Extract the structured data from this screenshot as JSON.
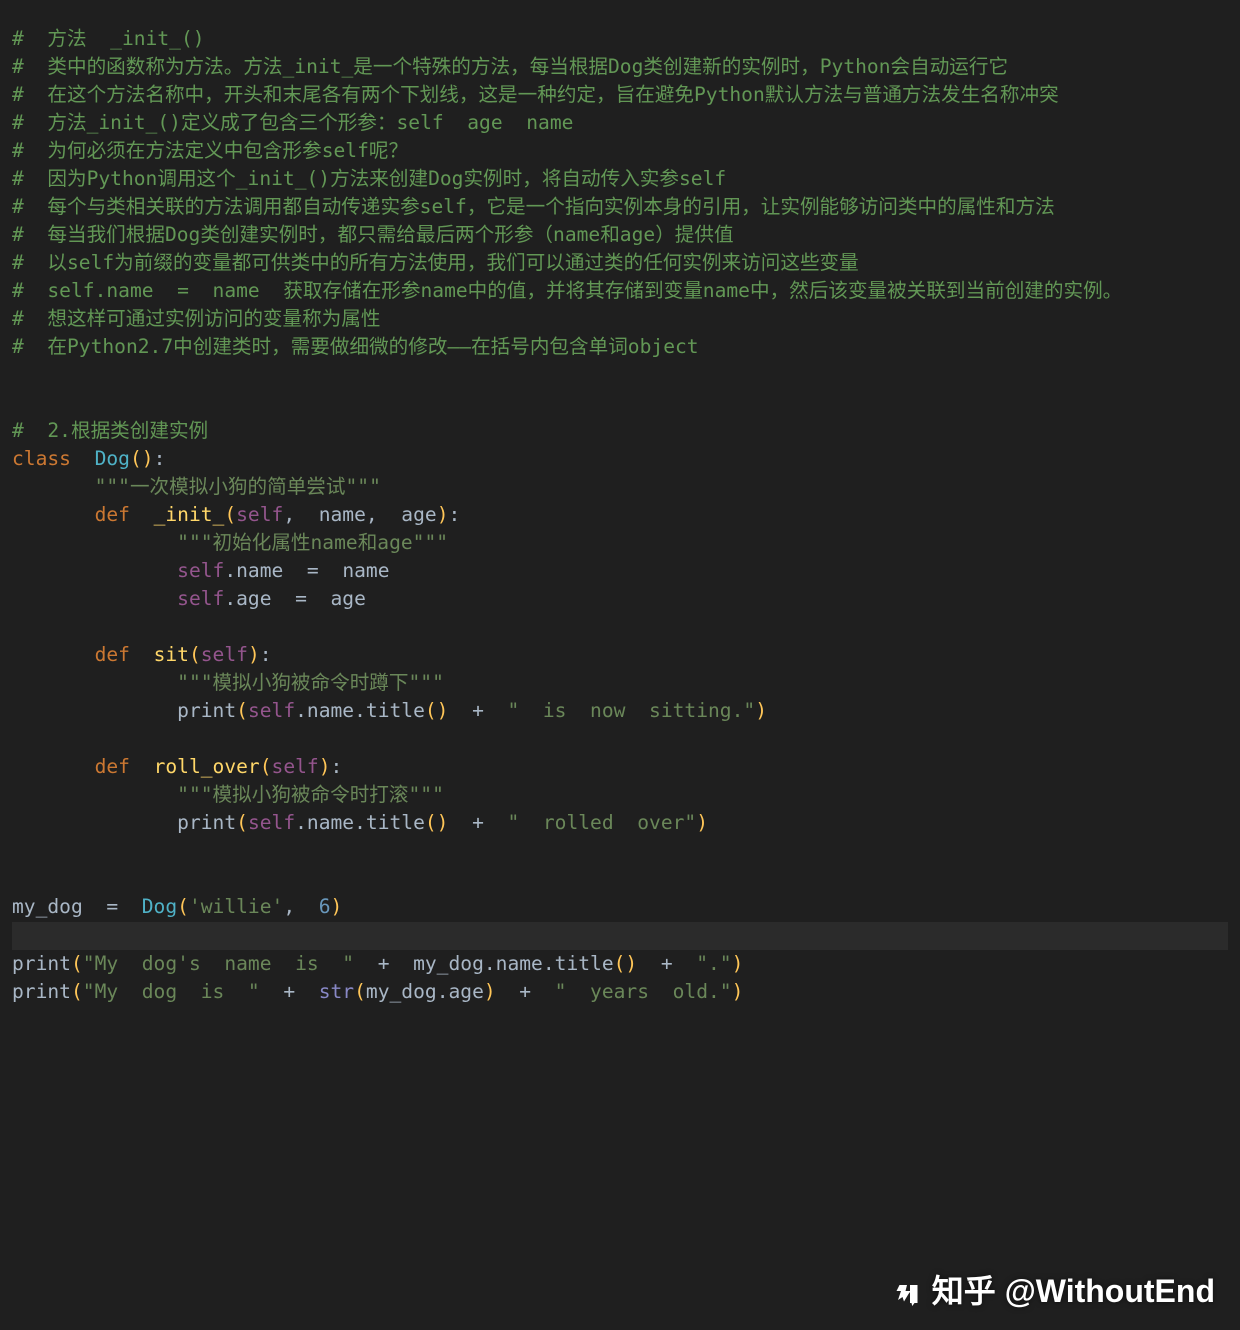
{
  "comments": {
    "c1": "#  方法  _init_()",
    "c2": "#  类中的函数称为方法。方法_init_是一个特殊的方法，每当根据Dog类创建新的实例时，Python会自动运行它",
    "c3": "#  在这个方法名称中，开头和末尾各有两个下划线，这是一种约定，旨在避免Python默认方法与普通方法发生名称冲突",
    "c4": "#  方法_init_()定义成了包含三个形参：self  age  name",
    "c5": "#  为何必须在方法定义中包含形参self呢？",
    "c6": "#  因为Python调用这个_init_()方法来创建Dog实例时，将自动传入实参self",
    "c7": "#  每个与类相关联的方法调用都自动传递实参self，它是一个指向实例本身的引用，让实例能够访问类中的属性和方法",
    "c8": "#  每当我们根据Dog类创建实例时，都只需给最后两个形参（name和age）提供值",
    "c9": "#  以self为前缀的变量都可供类中的所有方法使用，我们可以通过类的任何实例来访问这些变量",
    "c10": "#  self.name  =  name  获取存储在形参name中的值，并将其存储到变量name中，然后该变量被关联到当前创建的实例。",
    "c11": "#  想这样可通过实例访问的变量称为属性",
    "c12": "#  在Python2.7中创建类时，需要做细微的修改——在括号内包含单词object",
    "c13": "#  2.根据类创建实例"
  },
  "code": {
    "kw_class": "class",
    "classname": "Dog",
    "kw_def": "def",
    "m_init": "_init_",
    "m_sit": "sit",
    "m_roll": "roll_over",
    "self": "self",
    "p_name": "name",
    "p_age": "age",
    "attr_name": ".name",
    "attr_age": ".age",
    "attr_title": ".title",
    "doc_class": "\"\"\"一次模拟小狗的简单尝试\"\"\"",
    "doc_init": "\"\"\"初始化属性name和age\"\"\"",
    "doc_sit": "\"\"\"模拟小狗被命令时蹲下\"\"\"",
    "doc_roll": "\"\"\"模拟小狗被命令时打滚\"\"\"",
    "str_sitting": "\"  is  now  sitting.\"",
    "str_rolled": "\"  rolled  over\"",
    "str_willie": "'willie'",
    "num_6": "6",
    "bi_print": "print",
    "bi_str": "str",
    "var_mydog": "my_dog",
    "str_dogname": "\"My  dog's  name  is  \"",
    "str_period": "\".\"",
    "str_mydogis": "\"My  dog  is  \"",
    "str_yearsold": "\"  years  old.\""
  },
  "watermark": "知乎 @WithoutEnd"
}
